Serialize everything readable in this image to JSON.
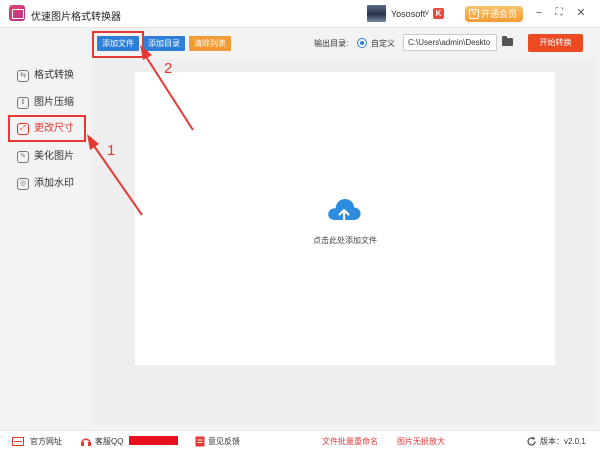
{
  "app": {
    "title": "优速图片格式转换器"
  },
  "user": {
    "name": "Yososoft",
    "badge": "K"
  },
  "titlebar": {
    "vip_label": "开通会员",
    "vip_icon": "V",
    "caret": "∨",
    "minimize": "−",
    "restore": "⛶",
    "close": "✕"
  },
  "toolbar": {
    "add_file": "添加文件",
    "add_dir": "添加目录",
    "clear_list": "清除列表",
    "output_label": "输出目录:",
    "radio_label": "自定义",
    "output_path": "C:\\Users\\admin\\Deskto",
    "start_label": "开始转换"
  },
  "sidebar": {
    "items": [
      {
        "label": "格式转换",
        "icon": "⇆"
      },
      {
        "label": "图片压缩",
        "icon": "⇕"
      },
      {
        "label": "更改尺寸",
        "icon": "⤢"
      },
      {
        "label": "美化图片",
        "icon": "✎"
      },
      {
        "label": "添加水印",
        "icon": "◎"
      }
    ]
  },
  "main": {
    "drop_text": "点击此处添加文件"
  },
  "annotations": {
    "one": "1",
    "two": "2"
  },
  "footer": {
    "website": "官方网址",
    "qq": "客服QQ",
    "feedback": "意见反馈",
    "batch_rename": "文件批量重命名",
    "lossless": "图片无损放大",
    "version": "版本：v2.0.1"
  },
  "colors": {
    "accent": "#2d7fd8",
    "danger": "#e53935",
    "orange": "#f39a33",
    "start": "#ec4a22",
    "active": "#e0342a"
  }
}
